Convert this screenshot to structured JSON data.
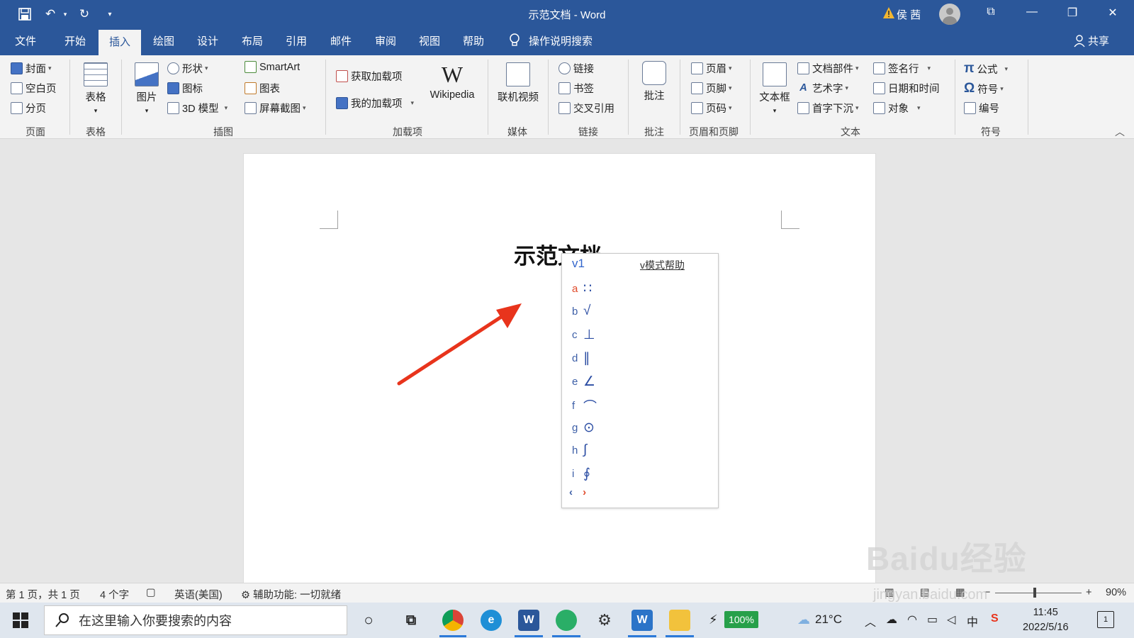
{
  "titlebar": {
    "doc_title": "示范文档  -  Word",
    "user_name": "侯 茜",
    "undo_glyph": "↶",
    "redo_glyph": "↻",
    "restore_glyph": "⧉",
    "minimize_glyph": "—",
    "maximize_glyph": "❐",
    "close_glyph": "✕"
  },
  "menu": {
    "tabs": [
      "文件",
      "开始",
      "插入",
      "绘图",
      "设计",
      "布局",
      "引用",
      "邮件",
      "审阅",
      "视图",
      "帮助"
    ],
    "active_tab": "插入",
    "search_label": "操作说明搜索",
    "share_label": "共享"
  },
  "ribbon": {
    "pages": {
      "cover": "封面",
      "blank": "空白页",
      "break": "分页",
      "group": "页面"
    },
    "tables": {
      "table": "表格",
      "group": "表格"
    },
    "illustrations": {
      "picture": "图片",
      "shapes": "形状",
      "icons": "图标",
      "model3d": "3D 模型",
      "smartart": "SmartArt",
      "chart": "图表",
      "screenshot": "屏幕截图",
      "group": "插图"
    },
    "addins": {
      "get": "获取加载项",
      "mine": "我的加载项",
      "wikipedia": "Wikipedia",
      "group": "加载项"
    },
    "media": {
      "video": "联机视频",
      "group": "媒体"
    },
    "links": {
      "link": "链接",
      "bookmark": "书签",
      "crossref": "交叉引用",
      "group": "链接"
    },
    "comments": {
      "comment": "批注",
      "group": "批注"
    },
    "header_footer": {
      "header": "页眉",
      "footer": "页脚",
      "page_number": "页码",
      "group": "页眉和页脚"
    },
    "text": {
      "textbox": "文本框",
      "quickparts": "文档部件",
      "wordart": "艺术字",
      "dropcap": "首字下沉",
      "signature": "签名行",
      "datetime": "日期和时间",
      "object": "对象",
      "group": "文本"
    },
    "symbols": {
      "equation": "公式",
      "symbol": "符号",
      "number": "编号",
      "group": "符号"
    }
  },
  "document": {
    "title": "示范文档"
  },
  "ime_popup": {
    "input": "v1",
    "help_label": "v模式帮助",
    "candidates": [
      {
        "key": "a",
        "value": "∷"
      },
      {
        "key": "b",
        "value": "√"
      },
      {
        "key": "c",
        "value": "⊥"
      },
      {
        "key": "d",
        "value": "∥"
      },
      {
        "key": "e",
        "value": "∠"
      },
      {
        "key": "f",
        "value": "⌒"
      },
      {
        "key": "g",
        "value": "⊙"
      },
      {
        "key": "h",
        "value": "∫"
      },
      {
        "key": "i",
        "value": "∮"
      }
    ],
    "prev": "‹",
    "next": "›"
  },
  "statusbar": {
    "page": "第 1 页，共 1 页",
    "words": "4 个字",
    "language": "英语(美国)",
    "accessibility": "辅助功能: 一切就绪",
    "zoom": "90%",
    "zoom_minus": "−",
    "zoom_plus": "+"
  },
  "taskbar": {
    "search_placeholder": "在这里输入你要搜索的内容",
    "battery": "100%",
    "temperature": "21°C",
    "time": "11:45",
    "date": "2022/5/16",
    "ime_lang": "中",
    "notification_count": "1"
  },
  "watermark": {
    "brand": "Baidu经验",
    "url": "jingyan.baidu.com"
  },
  "colors": {
    "word_blue": "#2b579a",
    "arrow_red": "#e8341c",
    "ribbon_bg": "#f3f3f3"
  }
}
